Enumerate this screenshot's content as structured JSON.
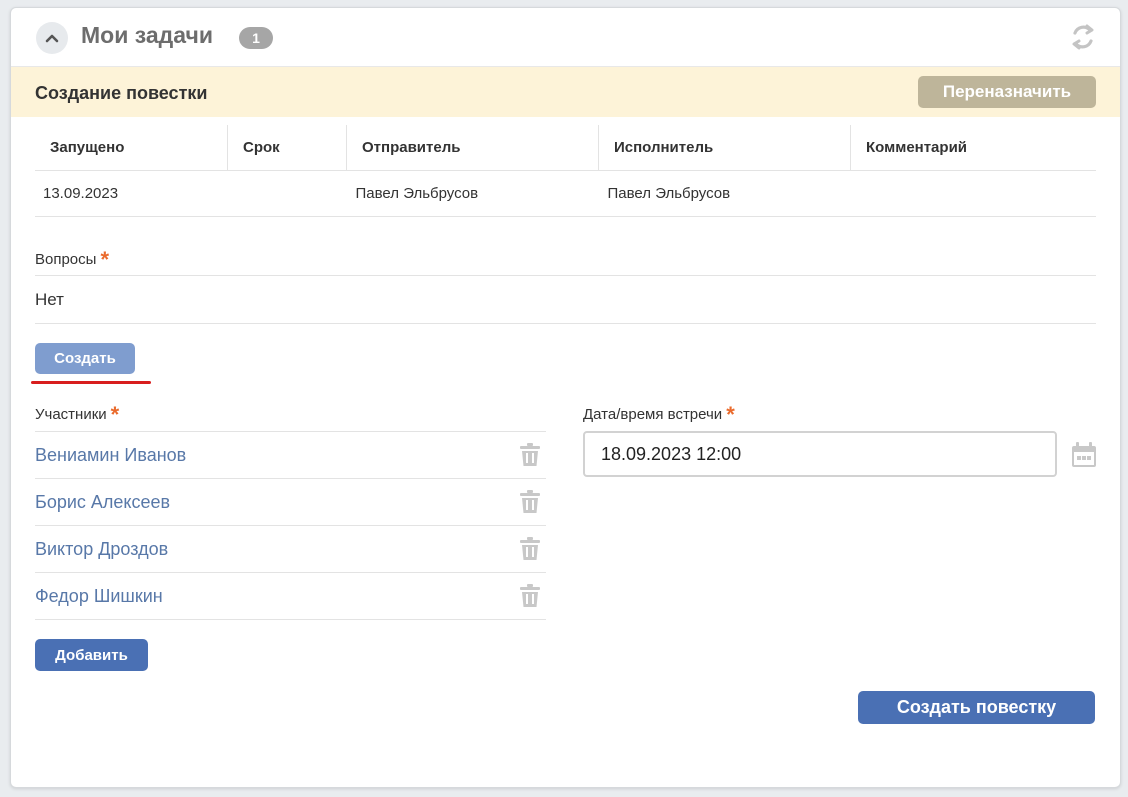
{
  "header": {
    "title": "Мои задачи",
    "badge_count": "1",
    "collapse_icon": "chevron-up-icon",
    "refresh_icon": "refresh-icon"
  },
  "task": {
    "title": "Создание повестки",
    "reassign_label": "Переназначить"
  },
  "info_table": {
    "columns": [
      "Запущено",
      "Срок",
      "Отправитель",
      "Исполнитель",
      "Комментарий"
    ],
    "row": [
      "13.09.2023",
      "",
      "Павел Эльбрусов",
      "Павел Эльбрусов",
      ""
    ]
  },
  "questions": {
    "label": "Вопросы",
    "required_mark": "*",
    "value": "Нет",
    "create_label": "Создать"
  },
  "participants": {
    "label": "Участники",
    "required_mark": "*",
    "items": [
      {
        "name": "Вениамин Иванов"
      },
      {
        "name": "Борис Алексеев"
      },
      {
        "name": "Виктор Дроздов"
      },
      {
        "name": "Федор Шишкин"
      }
    ],
    "delete_icon": "trash-icon",
    "add_label": "Добавить"
  },
  "meeting": {
    "label": "Дата/время встречи",
    "required_mark": "*",
    "value": "18.09.2023 12:00",
    "calendar_icon": "calendar-icon"
  },
  "footer": {
    "create_agenda_label": "Создать повестку"
  },
  "colors": {
    "task_bar_bg": "#fdf3d8",
    "primary_button": "#4a70b4",
    "light_button": "#7f9dcf",
    "reassign_button": "#beb59a",
    "required_star": "#ea6b2d",
    "link_text": "#5878a8",
    "highlight_underline": "#d81e1e"
  }
}
